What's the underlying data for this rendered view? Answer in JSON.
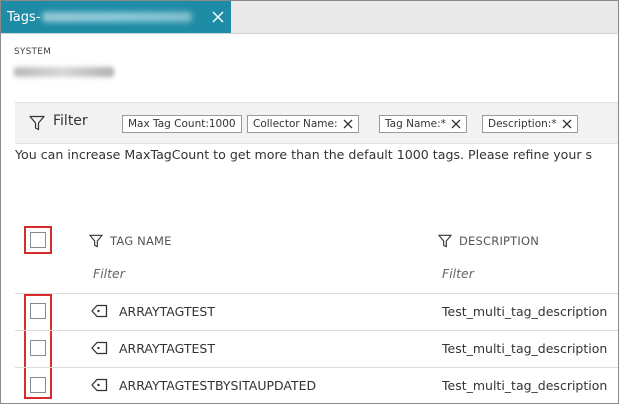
{
  "tab": {
    "title": "Tags-"
  },
  "system": {
    "label": "SYSTEM"
  },
  "filterbar": {
    "label": "Filter",
    "chips": [
      {
        "label": "Max Tag Count:1000",
        "removable": false
      },
      {
        "label": "Collector Name:",
        "removable": true
      },
      {
        "label": "Tag Name:*",
        "removable": true
      },
      {
        "label": "Description:*",
        "removable": true
      }
    ]
  },
  "info_message": "You can increase MaxTagCount to get more than the default 1000 tags. Please refine your s",
  "table": {
    "columns": [
      {
        "label": "TAG NAME",
        "filter_placeholder": "Filter"
      },
      {
        "label": "DESCRIPTION",
        "filter_placeholder": "Filter"
      }
    ],
    "rows": [
      {
        "name": "ARRAYTAGTEST",
        "description": "Test_multi_tag_description"
      },
      {
        "name": "ARRAYTAGTEST",
        "description": "Test_multi_tag_description"
      },
      {
        "name": "ARRAYTAGTESTBYSITAUPDATED",
        "description": "Test_multi_tag_description"
      }
    ]
  },
  "colors": {
    "tab_bg": "#1f8ca6",
    "highlight": "#d92b2b",
    "filterbar_bg": "#f2f2f2"
  }
}
